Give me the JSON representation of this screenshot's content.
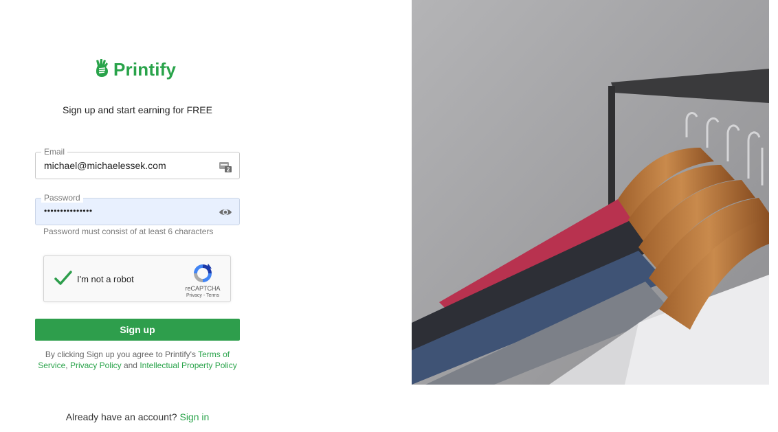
{
  "brand": {
    "name": "Printify",
    "color": "#29a34a",
    "logo_icon": "printify-hand-icon"
  },
  "headline": "Sign up and start earning for FREE",
  "email": {
    "label": "Email",
    "value": "michael@michaelessek.com",
    "icon": "password-manager-icon"
  },
  "password": {
    "label": "Password",
    "value": "•••••••••••••••",
    "icon": "eye-icon",
    "hint": "Password must consist of at least 6 characters"
  },
  "captcha": {
    "label": "I'm not a robot",
    "brand": "reCAPTCHA",
    "links": "Privacy - Terms",
    "checked": true
  },
  "signup_button": "Sign up",
  "legal": {
    "prefix": "By clicking Sign up you agree to Printify's ",
    "terms": "Terms of Service",
    "comma": ", ",
    "privacy": "Privacy Policy",
    "and": " and ",
    "ip": "Intellectual Property Policy"
  },
  "signin": {
    "prompt": "Already have an account? ",
    "link": "Sign in"
  },
  "colors": {
    "accent": "#2e9e4c",
    "link": "#29a34a",
    "autofill": "#e8f0fe"
  }
}
